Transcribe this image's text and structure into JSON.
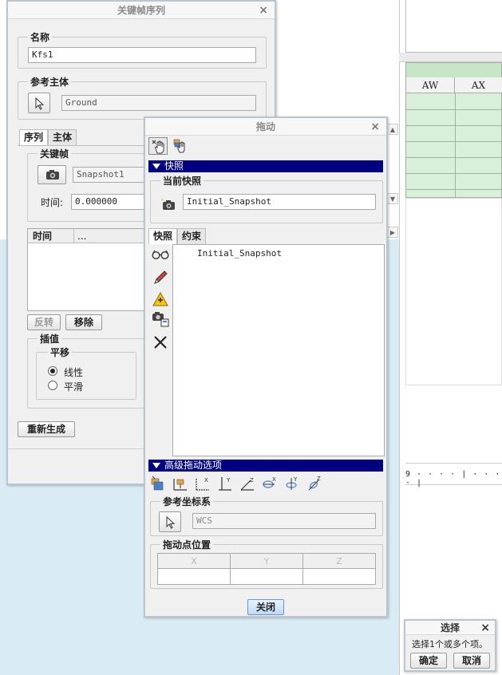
{
  "background": {
    "sheet_columns": [
      "AW",
      "AX"
    ],
    "ruler_text": "9 · · · · | · · · · |"
  },
  "keyframe_dialog": {
    "title": "关键帧序列",
    "name_group_label": "名称",
    "name_value": "Kfs1",
    "ref_body_group_label": "参考主体",
    "ref_body_value": "Ground",
    "tabs": [
      "序列",
      "主体"
    ],
    "keyframe_group_label": "关键帧",
    "snapshot_value": "Snapshot1",
    "time_label": "时间:",
    "time_value": "0.000000",
    "list_columns": [
      "时间",
      "..."
    ],
    "reverse_button": "反转",
    "remove_button": "移除",
    "interp_group_label": "插值",
    "translate_group_label": "平移",
    "radio_linear": "线性",
    "radio_smooth": "平滑",
    "regenerate_button": "重新生成"
  },
  "drag_dialog": {
    "title": "拖动",
    "snapshot_section": "快照",
    "current_snapshot_label": "当前快照",
    "current_snapshot_value": "Initial_Snapshot",
    "tabs": [
      "快照",
      "约束"
    ],
    "snapshot_list": [
      "Initial_Snapshot"
    ],
    "advanced_section": "高级拖动选项",
    "ref_coord_label": "参考坐标系",
    "ref_coord_value": "WCS",
    "drag_point_label": "拖动点位置",
    "xyz_headers": [
      "X",
      "Y",
      "Z"
    ],
    "close_button": "关闭"
  },
  "select_dialog": {
    "title": "选择",
    "message": "选择1个或多个项。",
    "ok_button": "确定",
    "cancel_button": "取消"
  }
}
